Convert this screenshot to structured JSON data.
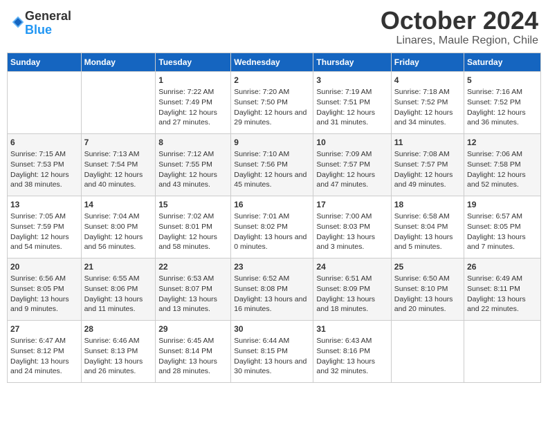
{
  "logo": {
    "general": "General",
    "blue": "Blue"
  },
  "header": {
    "month": "October 2024",
    "subtitle": "Linares, Maule Region, Chile"
  },
  "weekdays": [
    "Sunday",
    "Monday",
    "Tuesday",
    "Wednesday",
    "Thursday",
    "Friday",
    "Saturday"
  ],
  "weeks": [
    [
      {
        "day": "",
        "content": ""
      },
      {
        "day": "",
        "content": ""
      },
      {
        "day": "1",
        "content": "Sunrise: 7:22 AM\nSunset: 7:49 PM\nDaylight: 12 hours and 27 minutes."
      },
      {
        "day": "2",
        "content": "Sunrise: 7:20 AM\nSunset: 7:50 PM\nDaylight: 12 hours and 29 minutes."
      },
      {
        "day": "3",
        "content": "Sunrise: 7:19 AM\nSunset: 7:51 PM\nDaylight: 12 hours and 31 minutes."
      },
      {
        "day": "4",
        "content": "Sunrise: 7:18 AM\nSunset: 7:52 PM\nDaylight: 12 hours and 34 minutes."
      },
      {
        "day": "5",
        "content": "Sunrise: 7:16 AM\nSunset: 7:52 PM\nDaylight: 12 hours and 36 minutes."
      }
    ],
    [
      {
        "day": "6",
        "content": "Sunrise: 7:15 AM\nSunset: 7:53 PM\nDaylight: 12 hours and 38 minutes."
      },
      {
        "day": "7",
        "content": "Sunrise: 7:13 AM\nSunset: 7:54 PM\nDaylight: 12 hours and 40 minutes."
      },
      {
        "day": "8",
        "content": "Sunrise: 7:12 AM\nSunset: 7:55 PM\nDaylight: 12 hours and 43 minutes."
      },
      {
        "day": "9",
        "content": "Sunrise: 7:10 AM\nSunset: 7:56 PM\nDaylight: 12 hours and 45 minutes."
      },
      {
        "day": "10",
        "content": "Sunrise: 7:09 AM\nSunset: 7:57 PM\nDaylight: 12 hours and 47 minutes."
      },
      {
        "day": "11",
        "content": "Sunrise: 7:08 AM\nSunset: 7:57 PM\nDaylight: 12 hours and 49 minutes."
      },
      {
        "day": "12",
        "content": "Sunrise: 7:06 AM\nSunset: 7:58 PM\nDaylight: 12 hours and 52 minutes."
      }
    ],
    [
      {
        "day": "13",
        "content": "Sunrise: 7:05 AM\nSunset: 7:59 PM\nDaylight: 12 hours and 54 minutes."
      },
      {
        "day": "14",
        "content": "Sunrise: 7:04 AM\nSunset: 8:00 PM\nDaylight: 12 hours and 56 minutes."
      },
      {
        "day": "15",
        "content": "Sunrise: 7:02 AM\nSunset: 8:01 PM\nDaylight: 12 hours and 58 minutes."
      },
      {
        "day": "16",
        "content": "Sunrise: 7:01 AM\nSunset: 8:02 PM\nDaylight: 13 hours and 0 minutes."
      },
      {
        "day": "17",
        "content": "Sunrise: 7:00 AM\nSunset: 8:03 PM\nDaylight: 13 hours and 3 minutes."
      },
      {
        "day": "18",
        "content": "Sunrise: 6:58 AM\nSunset: 8:04 PM\nDaylight: 13 hours and 5 minutes."
      },
      {
        "day": "19",
        "content": "Sunrise: 6:57 AM\nSunset: 8:05 PM\nDaylight: 13 hours and 7 minutes."
      }
    ],
    [
      {
        "day": "20",
        "content": "Sunrise: 6:56 AM\nSunset: 8:05 PM\nDaylight: 13 hours and 9 minutes."
      },
      {
        "day": "21",
        "content": "Sunrise: 6:55 AM\nSunset: 8:06 PM\nDaylight: 13 hours and 11 minutes."
      },
      {
        "day": "22",
        "content": "Sunrise: 6:53 AM\nSunset: 8:07 PM\nDaylight: 13 hours and 13 minutes."
      },
      {
        "day": "23",
        "content": "Sunrise: 6:52 AM\nSunset: 8:08 PM\nDaylight: 13 hours and 16 minutes."
      },
      {
        "day": "24",
        "content": "Sunrise: 6:51 AM\nSunset: 8:09 PM\nDaylight: 13 hours and 18 minutes."
      },
      {
        "day": "25",
        "content": "Sunrise: 6:50 AM\nSunset: 8:10 PM\nDaylight: 13 hours and 20 minutes."
      },
      {
        "day": "26",
        "content": "Sunrise: 6:49 AM\nSunset: 8:11 PM\nDaylight: 13 hours and 22 minutes."
      }
    ],
    [
      {
        "day": "27",
        "content": "Sunrise: 6:47 AM\nSunset: 8:12 PM\nDaylight: 13 hours and 24 minutes."
      },
      {
        "day": "28",
        "content": "Sunrise: 6:46 AM\nSunset: 8:13 PM\nDaylight: 13 hours and 26 minutes."
      },
      {
        "day": "29",
        "content": "Sunrise: 6:45 AM\nSunset: 8:14 PM\nDaylight: 13 hours and 28 minutes."
      },
      {
        "day": "30",
        "content": "Sunrise: 6:44 AM\nSunset: 8:15 PM\nDaylight: 13 hours and 30 minutes."
      },
      {
        "day": "31",
        "content": "Sunrise: 6:43 AM\nSunset: 8:16 PM\nDaylight: 13 hours and 32 minutes."
      },
      {
        "day": "",
        "content": ""
      },
      {
        "day": "",
        "content": ""
      }
    ]
  ]
}
